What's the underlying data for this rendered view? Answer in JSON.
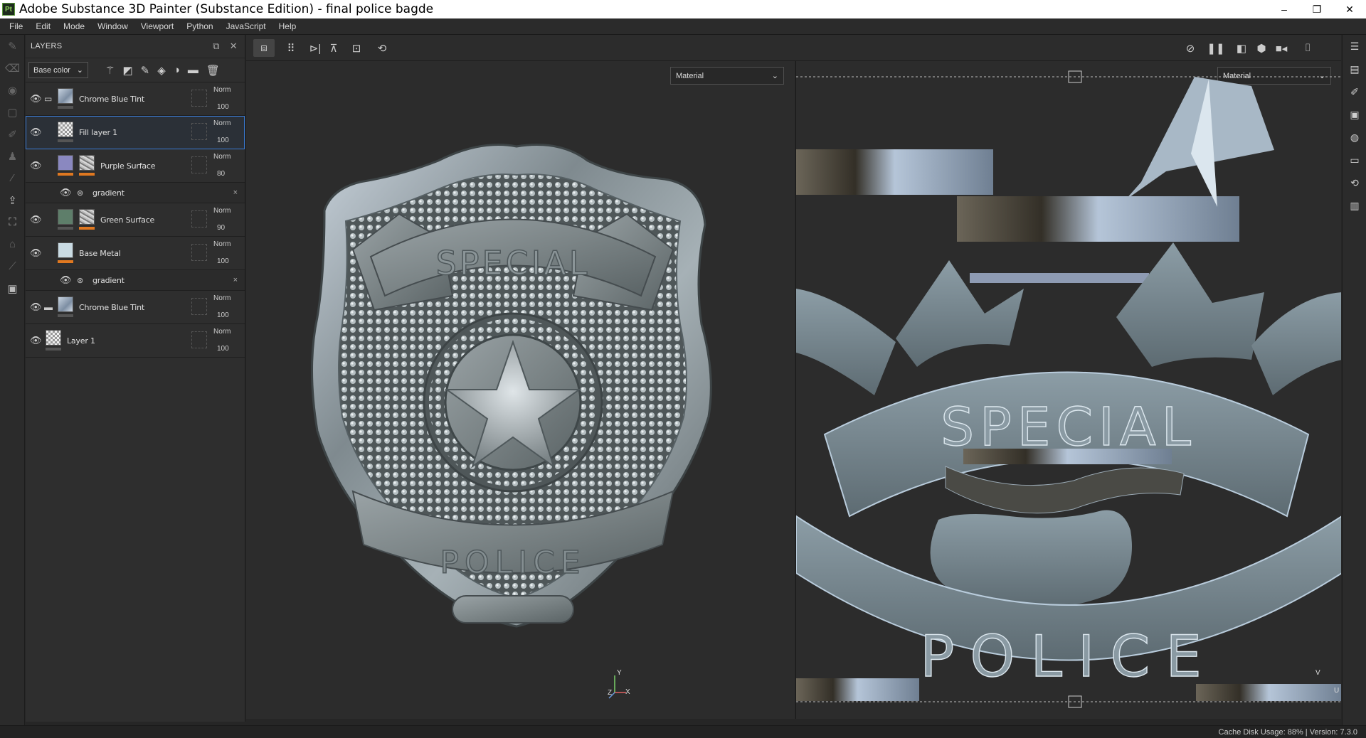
{
  "window": {
    "title": "Adobe Substance 3D Painter (Substance Edition) - final police bagde",
    "app_icon": "Pt",
    "minimize": "–",
    "restore": "❐",
    "close": "✕"
  },
  "menu": [
    "File",
    "Edit",
    "Mode",
    "Window",
    "Viewport",
    "Python",
    "JavaScript",
    "Help"
  ],
  "layers_panel": {
    "title": "LAYERS",
    "channel_select": "Base color",
    "layers": [
      {
        "name": "Chrome Blue Tint",
        "blend": "Norm",
        "opacity": "100"
      },
      {
        "name": "Fill layer 1",
        "blend": "Norm",
        "opacity": "100"
      },
      {
        "name": "Purple Surface",
        "blend": "Norm",
        "opacity": "80"
      },
      {
        "name": "gradient"
      },
      {
        "name": "Green Surface",
        "blend": "Norm",
        "opacity": "90"
      },
      {
        "name": "Base Metal",
        "blend": "Norm",
        "opacity": "100"
      },
      {
        "name": "gradient"
      },
      {
        "name": "Chrome Blue Tint",
        "blend": "Norm",
        "opacity": "100"
      },
      {
        "name": "Layer 1",
        "blend": "Norm",
        "opacity": "100"
      }
    ]
  },
  "viewport3d": {
    "display_select": "Material",
    "badge_top_text": "SPECIAL",
    "badge_bottom_text": "POLICE",
    "axis_y": "Y",
    "axis_x": "X",
    "axis_z": "Z"
  },
  "viewport2d": {
    "display_select": "Material",
    "uv_top_text": "SPECIAL",
    "uv_bottom_text": "POLICE",
    "axis_v": "V",
    "axis_u": "U"
  },
  "status": {
    "text": "Cache Disk Usage:   88%  |  Version: 7.3.0"
  },
  "colors": {
    "accent_selection": "#3a7bd5",
    "orange_mask": "#e07820",
    "panel_bg": "#2e2e2e"
  }
}
